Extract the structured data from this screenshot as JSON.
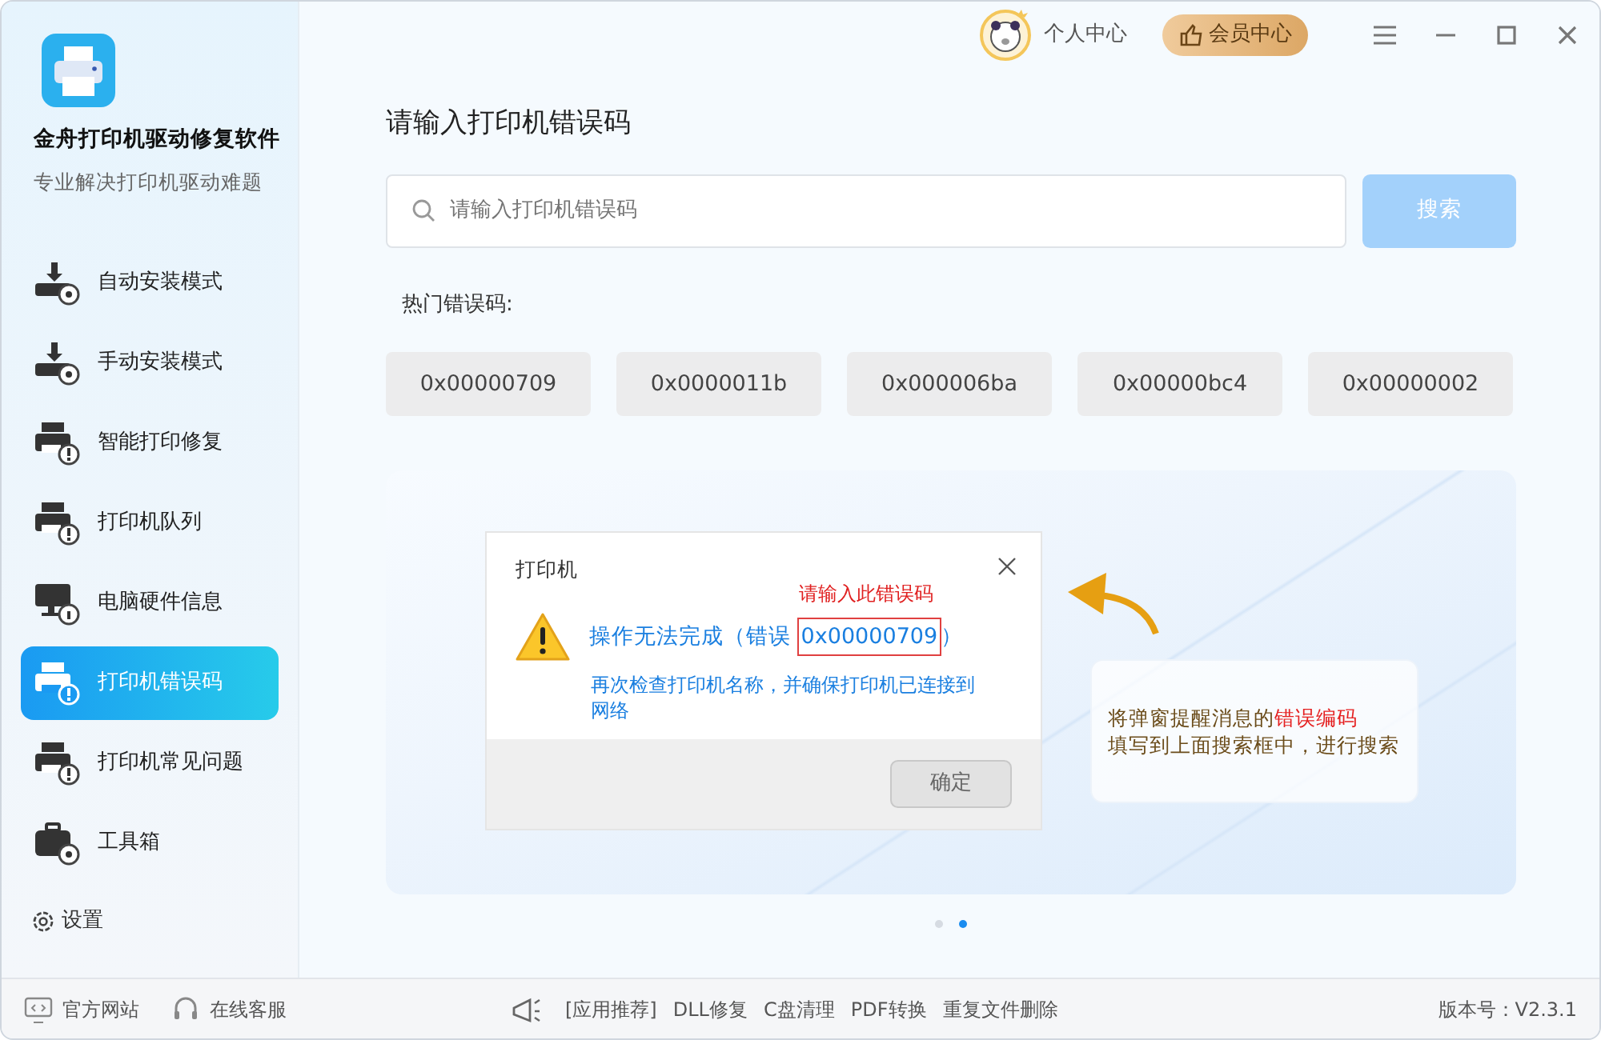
{
  "app": {
    "name": "金舟打印机驱动修复软件",
    "subtitle": "专业解决打印机驱动难题"
  },
  "nav": [
    {
      "label": "自动安装模式",
      "kind": "download",
      "selected": false
    },
    {
      "label": "手动安装模式",
      "kind": "download",
      "selected": false
    },
    {
      "label": "智能打印修复",
      "kind": "printer",
      "selected": false
    },
    {
      "label": "打印机队列",
      "kind": "printer",
      "selected": false
    },
    {
      "label": "电脑硬件信息",
      "kind": "monitor",
      "selected": false
    },
    {
      "label": "打印机错误码",
      "kind": "printer",
      "selected": true
    },
    {
      "label": "打印机常见问题",
      "kind": "printer",
      "selected": false
    },
    {
      "label": "工具箱",
      "kind": "toolbox",
      "selected": false
    }
  ],
  "settings": "设置",
  "topbar": {
    "user": "个人中心",
    "member": "会员中心"
  },
  "heading": "请输入打印机错误码",
  "search": {
    "placeholder": "请输入打印机错误码",
    "button": "搜索"
  },
  "hot_label": "热门错误码:",
  "hot_codes": [
    "0x00000709",
    "0x0000011b",
    "0x000006ba",
    "0x00000bc4",
    "0x00000002"
  ],
  "banner": {
    "dialog": {
      "title": "打印机",
      "annotation": "请输入此错误码",
      "message_prefix": "操作无法完成（错误 ",
      "code": "0x00000709",
      "message_suffix": "）",
      "detail": "再次检查打印机名称，并确保打印机已连接到网络",
      "ok": "确定"
    },
    "tip": {
      "line1": "将弹窗提醒消息的",
      "highlight": "错误编码",
      "line2": "填写到上面搜索框中，进行搜索"
    },
    "dots": [
      {
        "selected": false
      },
      {
        "selected": true
      }
    ]
  },
  "footer": {
    "links": [
      "官方网站",
      "在线客服"
    ],
    "promo_label": "[应用推荐]",
    "promos": [
      "DLL修复",
      "C盘清理",
      "PDF转换",
      "重复文件删除"
    ],
    "version": "版本号：V2.3.1"
  }
}
